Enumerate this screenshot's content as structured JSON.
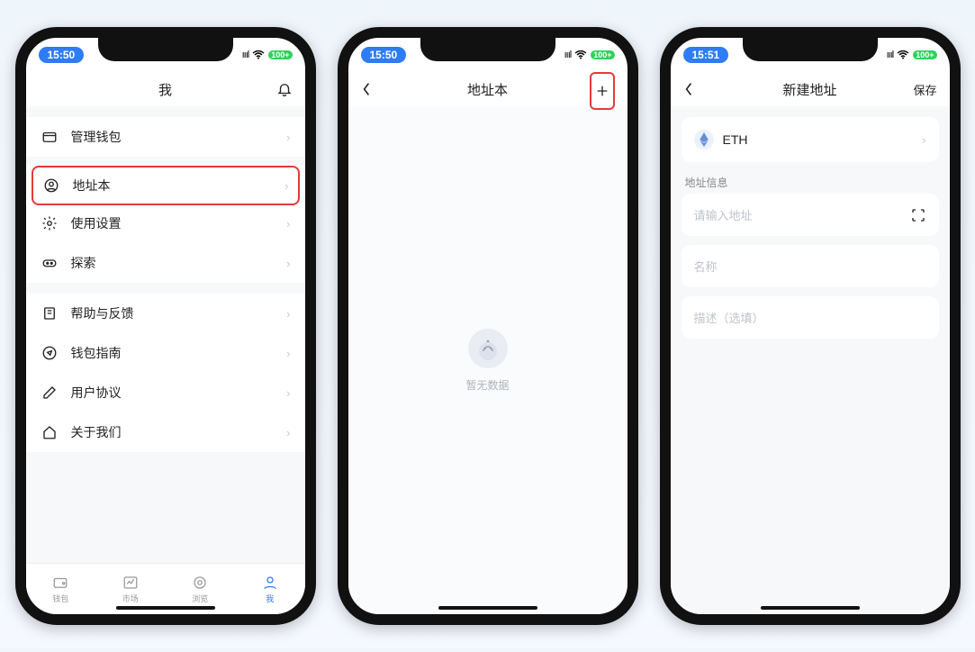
{
  "status": {
    "time_a": "15:50",
    "time_b": "15:50",
    "time_c": "15:51",
    "signal": "ıııl",
    "wifi": "wifi",
    "batt": "100+"
  },
  "screen1": {
    "title": "我",
    "rows": {
      "manage_wallet": "管理钱包",
      "address_book": "地址本",
      "settings": "使用设置",
      "explore": "探索",
      "help": "帮助与反馈",
      "guide": "钱包指南",
      "agreement": "用户协议",
      "about": "关于我们"
    },
    "tabs": {
      "wallet": "钱包",
      "market": "市场",
      "browse": "浏览",
      "me": "我"
    }
  },
  "screen2": {
    "title": "地址本",
    "empty": "暂无数据"
  },
  "screen3": {
    "title": "新建地址",
    "save": "保存",
    "coin": "ETH",
    "section": "地址信息",
    "addr_ph": "请输入地址",
    "name_ph": "名称",
    "desc_ph": "描述（选填）"
  }
}
